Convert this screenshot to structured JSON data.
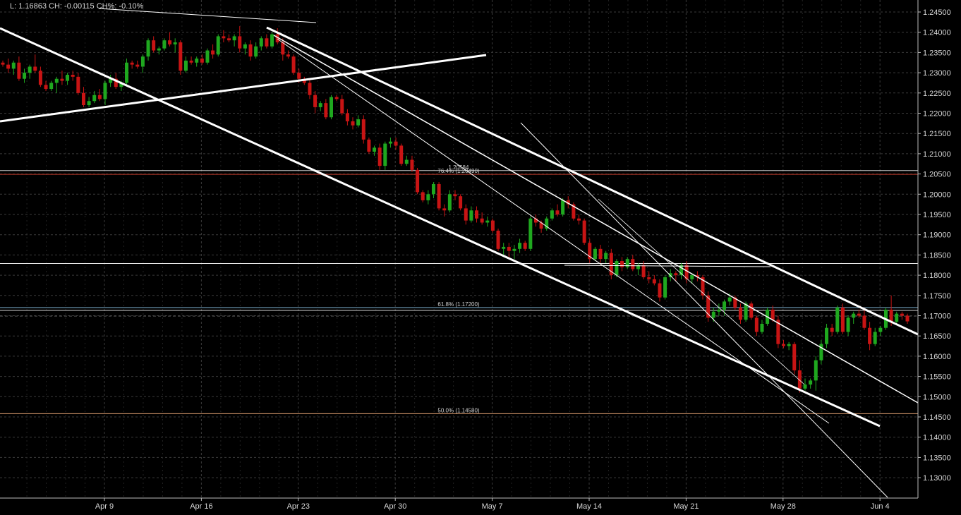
{
  "header": {
    "info_text": "L: 1.16863 CH: -0.00115 CH%: -0.10%"
  },
  "colors": {
    "background": "#000000",
    "up_bar": "#1fa81f",
    "down_bar": "#c81414",
    "grid": "#3a3a3a",
    "trendline": "#ffffff",
    "fib_level": "#c0392b",
    "axis_text": "#d8d8d8"
  },
  "chart_data": {
    "type": "candlestick",
    "timeframe": "4h",
    "y_axis": {
      "position": "right",
      "ylim": [
        1.1265,
        1.2475
      ],
      "ticks": [
        "1.24500",
        "1.24000",
        "1.23500",
        "1.23000",
        "1.22500",
        "1.22000",
        "1.21500",
        "1.21000",
        "1.20500",
        "1.20000",
        "1.19500",
        "1.19000",
        "1.18500",
        "1.18000",
        "1.17500",
        "1.17000",
        "1.16500",
        "1.16000",
        "1.15500",
        "1.15000",
        "1.14500",
        "1.14000",
        "1.13500",
        "1.13000"
      ]
    },
    "x_axis": {
      "ticks": [
        "Apr 9",
        "Apr 16",
        "Apr 23",
        "Apr 30",
        "May 7",
        "May 14",
        "May 21",
        "May 28",
        "Jun 4"
      ]
    },
    "grid": true,
    "candles": [
      [
        1.2325,
        1.233,
        1.2315,
        1.232
      ],
      [
        1.232,
        1.2335,
        1.23,
        1.231
      ],
      [
        1.231,
        1.233,
        1.2295,
        1.2325
      ],
      [
        1.2325,
        1.234,
        1.228,
        1.2285
      ],
      [
        1.2285,
        1.231,
        1.2275,
        1.23
      ],
      [
        1.23,
        1.232,
        1.2285,
        1.2315
      ],
      [
        1.2315,
        1.2345,
        1.23,
        1.2305
      ],
      [
        1.2305,
        1.2315,
        1.2265,
        1.227
      ],
      [
        1.227,
        1.228,
        1.2255,
        1.226
      ],
      [
        1.226,
        1.228,
        1.2255,
        1.2275
      ],
      [
        1.2275,
        1.229,
        1.225,
        1.2285
      ],
      [
        1.2285,
        1.2305,
        1.227,
        1.228
      ],
      [
        1.228,
        1.23,
        1.227,
        1.2295
      ],
      [
        1.2295,
        1.2305,
        1.228,
        1.229
      ],
      [
        1.229,
        1.23,
        1.2245,
        1.225
      ],
      [
        1.225,
        1.2265,
        1.2215,
        1.222
      ],
      [
        1.222,
        1.224,
        1.2215,
        1.223
      ],
      [
        1.223,
        1.2255,
        1.2225,
        1.2245
      ],
      [
        1.2245,
        1.226,
        1.223,
        1.2235
      ],
      [
        1.2235,
        1.228,
        1.222,
        1.2275
      ],
      [
        1.2275,
        1.2295,
        1.2265,
        1.2285
      ],
      [
        1.2285,
        1.23,
        1.226,
        1.2265
      ],
      [
        1.2265,
        1.228,
        1.2255,
        1.2275
      ],
      [
        1.2275,
        1.2335,
        1.227,
        1.2325
      ],
      [
        1.2325,
        1.233,
        1.231,
        1.232
      ],
      [
        1.232,
        1.233,
        1.231,
        1.2315
      ],
      [
        1.2315,
        1.2345,
        1.23,
        1.234
      ],
      [
        1.234,
        1.2385,
        1.233,
        1.238
      ],
      [
        1.238,
        1.239,
        1.235,
        1.2355
      ],
      [
        1.2355,
        1.2365,
        1.2345,
        1.236
      ],
      [
        1.236,
        1.2385,
        1.2355,
        1.238
      ],
      [
        1.238,
        1.24,
        1.2365,
        1.237
      ],
      [
        1.237,
        1.2385,
        1.235,
        1.2375
      ],
      [
        1.2375,
        1.238,
        1.2295,
        1.2305
      ],
      [
        1.2305,
        1.234,
        1.23,
        1.233
      ],
      [
        1.233,
        1.234,
        1.232,
        1.2325
      ],
      [
        1.2325,
        1.234,
        1.2315,
        1.2335
      ],
      [
        1.2335,
        1.2345,
        1.232,
        1.2325
      ],
      [
        1.2325,
        1.236,
        1.232,
        1.2355
      ],
      [
        1.2355,
        1.237,
        1.2335,
        1.2345
      ],
      [
        1.2345,
        1.2395,
        1.234,
        1.239
      ],
      [
        1.239,
        1.2405,
        1.2375,
        1.2385
      ],
      [
        1.2385,
        1.2395,
        1.2375,
        1.238
      ],
      [
        1.238,
        1.2395,
        1.2365,
        1.239
      ],
      [
        1.239,
        1.2415,
        1.235,
        1.236
      ],
      [
        1.236,
        1.2375,
        1.2345,
        1.237
      ],
      [
        1.237,
        1.238,
        1.233,
        1.234
      ],
      [
        1.234,
        1.2375,
        1.2335,
        1.2365
      ],
      [
        1.2365,
        1.239,
        1.2355,
        1.2385
      ],
      [
        1.2385,
        1.2395,
        1.236,
        1.2365
      ],
      [
        1.2365,
        1.24,
        1.236,
        1.2395
      ],
      [
        1.2395,
        1.241,
        1.237,
        1.2375
      ],
      [
        1.2375,
        1.2385,
        1.233,
        1.2345
      ],
      [
        1.2345,
        1.2355,
        1.2335,
        1.234
      ],
      [
        1.234,
        1.2345,
        1.2295,
        1.23
      ],
      [
        1.23,
        1.231,
        1.2275,
        1.2285
      ],
      [
        1.2285,
        1.229,
        1.227,
        1.2275
      ],
      [
        1.2275,
        1.2285,
        1.2235,
        1.2245
      ],
      [
        1.2245,
        1.2255,
        1.22,
        1.2215
      ],
      [
        1.2215,
        1.223,
        1.2205,
        1.2225
      ],
      [
        1.2225,
        1.2235,
        1.2185,
        1.219
      ],
      [
        1.219,
        1.2245,
        1.2185,
        1.224
      ],
      [
        1.224,
        1.2245,
        1.223,
        1.2235
      ],
      [
        1.2235,
        1.2245,
        1.2195,
        1.22
      ],
      [
        1.22,
        1.221,
        1.217,
        1.218
      ],
      [
        1.218,
        1.219,
        1.216,
        1.217
      ],
      [
        1.217,
        1.2195,
        1.2165,
        1.2185
      ],
      [
        1.2185,
        1.2195,
        1.2125,
        1.2135
      ],
      [
        1.2135,
        1.214,
        1.21,
        1.2105
      ],
      [
        1.2105,
        1.212,
        1.2095,
        1.2115
      ],
      [
        1.2115,
        1.2125,
        1.206,
        1.207
      ],
      [
        1.207,
        1.213,
        1.206,
        1.2125
      ],
      [
        1.2125,
        1.214,
        1.2115,
        1.213
      ],
      [
        1.213,
        1.214,
        1.211,
        1.212
      ],
      [
        1.212,
        1.2125,
        1.207,
        1.2075
      ],
      [
        1.2075,
        1.2095,
        1.207,
        1.2085
      ],
      [
        1.2085,
        1.2095,
        1.2055,
        1.206
      ],
      [
        1.206,
        1.2065,
        1.2,
        1.2005
      ],
      [
        1.2005,
        1.201,
        1.198,
        1.1985
      ],
      [
        1.1985,
        1.201,
        1.1975,
        1.2
      ],
      [
        1.2,
        1.203,
        1.199,
        1.2025
      ],
      [
        1.2025,
        1.203,
        1.196,
        1.1965
      ],
      [
        1.1965,
        1.1975,
        1.1945,
        1.196
      ],
      [
        1.196,
        1.201,
        1.1955,
        1.2
      ],
      [
        1.2,
        1.201,
        1.1985,
        1.1995
      ],
      [
        1.1995,
        1.2,
        1.196,
        1.1965
      ],
      [
        1.1965,
        1.1975,
        1.1925,
        1.1935
      ],
      [
        1.1935,
        1.197,
        1.193,
        1.196
      ],
      [
        1.196,
        1.197,
        1.193,
        1.194
      ],
      [
        1.194,
        1.1955,
        1.1925,
        1.193
      ],
      [
        1.193,
        1.1945,
        1.192,
        1.1935
      ],
      [
        1.1935,
        1.194,
        1.1905,
        1.191
      ],
      [
        1.191,
        1.1915,
        1.186,
        1.1865
      ],
      [
        1.1865,
        1.188,
        1.185,
        1.187
      ],
      [
        1.187,
        1.188,
        1.1845,
        1.186
      ],
      [
        1.186,
        1.1875,
        1.184,
        1.1865
      ],
      [
        1.1865,
        1.189,
        1.1855,
        1.188
      ],
      [
        1.188,
        1.1885,
        1.186,
        1.1865
      ],
      [
        1.1865,
        1.1945,
        1.186,
        1.194
      ],
      [
        1.194,
        1.195,
        1.192,
        1.193
      ],
      [
        1.193,
        1.1935,
        1.1905,
        1.1915
      ],
      [
        1.1915,
        1.1945,
        1.191,
        1.194
      ],
      [
        1.194,
        1.1965,
        1.1935,
        1.196
      ],
      [
        1.196,
        1.1975,
        1.1945,
        1.195
      ],
      [
        1.195,
        1.199,
        1.1945,
        1.1985
      ],
      [
        1.1985,
        1.1995,
        1.1965,
        1.1975
      ],
      [
        1.1975,
        1.198,
        1.1935,
        1.194
      ],
      [
        1.194,
        1.195,
        1.1925,
        1.1935
      ],
      [
        1.1935,
        1.194,
        1.1875,
        1.188
      ],
      [
        1.188,
        1.189,
        1.183,
        1.184
      ],
      [
        1.184,
        1.187,
        1.1835,
        1.1865
      ],
      [
        1.1865,
        1.1875,
        1.183,
        1.184
      ],
      [
        1.184,
        1.186,
        1.183,
        1.1855
      ],
      [
        1.1855,
        1.1865,
        1.179,
        1.18
      ],
      [
        1.18,
        1.184,
        1.1795,
        1.1835
      ],
      [
        1.1835,
        1.1845,
        1.181,
        1.182
      ],
      [
        1.182,
        1.1845,
        1.1815,
        1.184
      ],
      [
        1.184,
        1.185,
        1.181,
        1.1815
      ],
      [
        1.1815,
        1.183,
        1.18,
        1.1825
      ],
      [
        1.1825,
        1.1835,
        1.179,
        1.1795
      ],
      [
        1.1795,
        1.181,
        1.178,
        1.179
      ],
      [
        1.179,
        1.18,
        1.1775,
        1.178
      ],
      [
        1.178,
        1.179,
        1.1735,
        1.1745
      ],
      [
        1.1745,
        1.18,
        1.174,
        1.1795
      ],
      [
        1.1795,
        1.1815,
        1.1785,
        1.1805
      ],
      [
        1.1805,
        1.181,
        1.1785,
        1.18
      ],
      [
        1.18,
        1.183,
        1.179,
        1.1825
      ],
      [
        1.1825,
        1.1835,
        1.178,
        1.179
      ],
      [
        1.179,
        1.1805,
        1.178,
        1.18
      ],
      [
        1.18,
        1.181,
        1.1785,
        1.1795
      ],
      [
        1.1795,
        1.18,
        1.174,
        1.175
      ],
      [
        1.175,
        1.176,
        1.1685,
        1.1695
      ],
      [
        1.1695,
        1.172,
        1.1685,
        1.171
      ],
      [
        1.171,
        1.173,
        1.17,
        1.1715
      ],
      [
        1.1715,
        1.174,
        1.17,
        1.1735
      ],
      [
        1.1735,
        1.1755,
        1.1725,
        1.1745
      ],
      [
        1.1745,
        1.175,
        1.1715,
        1.172
      ],
      [
        1.172,
        1.173,
        1.168,
        1.169
      ],
      [
        1.169,
        1.1735,
        1.1685,
        1.173
      ],
      [
        1.173,
        1.1735,
        1.169,
        1.1695
      ],
      [
        1.1695,
        1.17,
        1.165,
        1.166
      ],
      [
        1.166,
        1.169,
        1.1655,
        1.168
      ],
      [
        1.168,
        1.172,
        1.1675,
        1.1715
      ],
      [
        1.1715,
        1.1725,
        1.1685,
        1.169
      ],
      [
        1.169,
        1.17,
        1.162,
        1.163
      ],
      [
        1.163,
        1.164,
        1.162,
        1.1625
      ],
      [
        1.1625,
        1.1635,
        1.1615,
        1.163
      ],
      [
        1.163,
        1.1635,
        1.1555,
        1.1565
      ],
      [
        1.1565,
        1.159,
        1.151,
        1.152
      ],
      [
        1.152,
        1.1545,
        1.1515,
        1.153
      ],
      [
        1.153,
        1.1545,
        1.152,
        1.154
      ],
      [
        1.154,
        1.16,
        1.1515,
        1.159
      ],
      [
        1.159,
        1.164,
        1.158,
        1.163
      ],
      [
        1.163,
        1.168,
        1.162,
        1.167
      ],
      [
        1.167,
        1.168,
        1.165,
        1.166
      ],
      [
        1.166,
        1.1725,
        1.1655,
        1.172
      ],
      [
        1.172,
        1.173,
        1.1655,
        1.166
      ],
      [
        1.166,
        1.17,
        1.165,
        1.1695
      ],
      [
        1.1695,
        1.171,
        1.168,
        1.1705
      ],
      [
        1.1705,
        1.1715,
        1.1695,
        1.17
      ],
      [
        1.17,
        1.172,
        1.1665,
        1.167
      ],
      [
        1.167,
        1.1685,
        1.1615,
        1.163
      ],
      [
        1.163,
        1.167,
        1.1625,
        1.166
      ],
      [
        1.166,
        1.1675,
        1.165,
        1.167
      ],
      [
        1.167,
        1.172,
        1.1665,
        1.1715
      ],
      [
        1.1715,
        1.175,
        1.1675,
        1.1685
      ],
      [
        1.1685,
        1.171,
        1.168,
        1.1705
      ],
      [
        1.1705,
        1.171,
        1.169,
        1.17
      ],
      [
        1.17,
        1.1705,
        1.168,
        1.1686
      ]
    ],
    "horizontal_lines": [
      {
        "price": 1.20584,
        "color": "#d0d0d0",
        "label": "1.20584"
      },
      {
        "price": 1.2049,
        "color": "#c0392b",
        "label": "76.4% (1.20490)"
      },
      {
        "price": 1.1829,
        "color": "#e8e8e8",
        "label": ""
      },
      {
        "price": 1.172,
        "color": "#7fb3d5",
        "label": "61.8% (1.17200)"
      },
      {
        "price": 1.1713,
        "color": "#d0d0d0",
        "label": ""
      },
      {
        "price": 1.1699,
        "color": "#555555",
        "label": "",
        "dashed": true
      },
      {
        "price": 1.1458,
        "color": "#e0a070",
        "label": "50.0% (1.14580)"
      }
    ],
    "fib_labels": [
      "1.20584",
      "76.4% (1.20490)",
      "61.8% (1.17200)",
      "50.0% (1.14580)"
    ]
  }
}
